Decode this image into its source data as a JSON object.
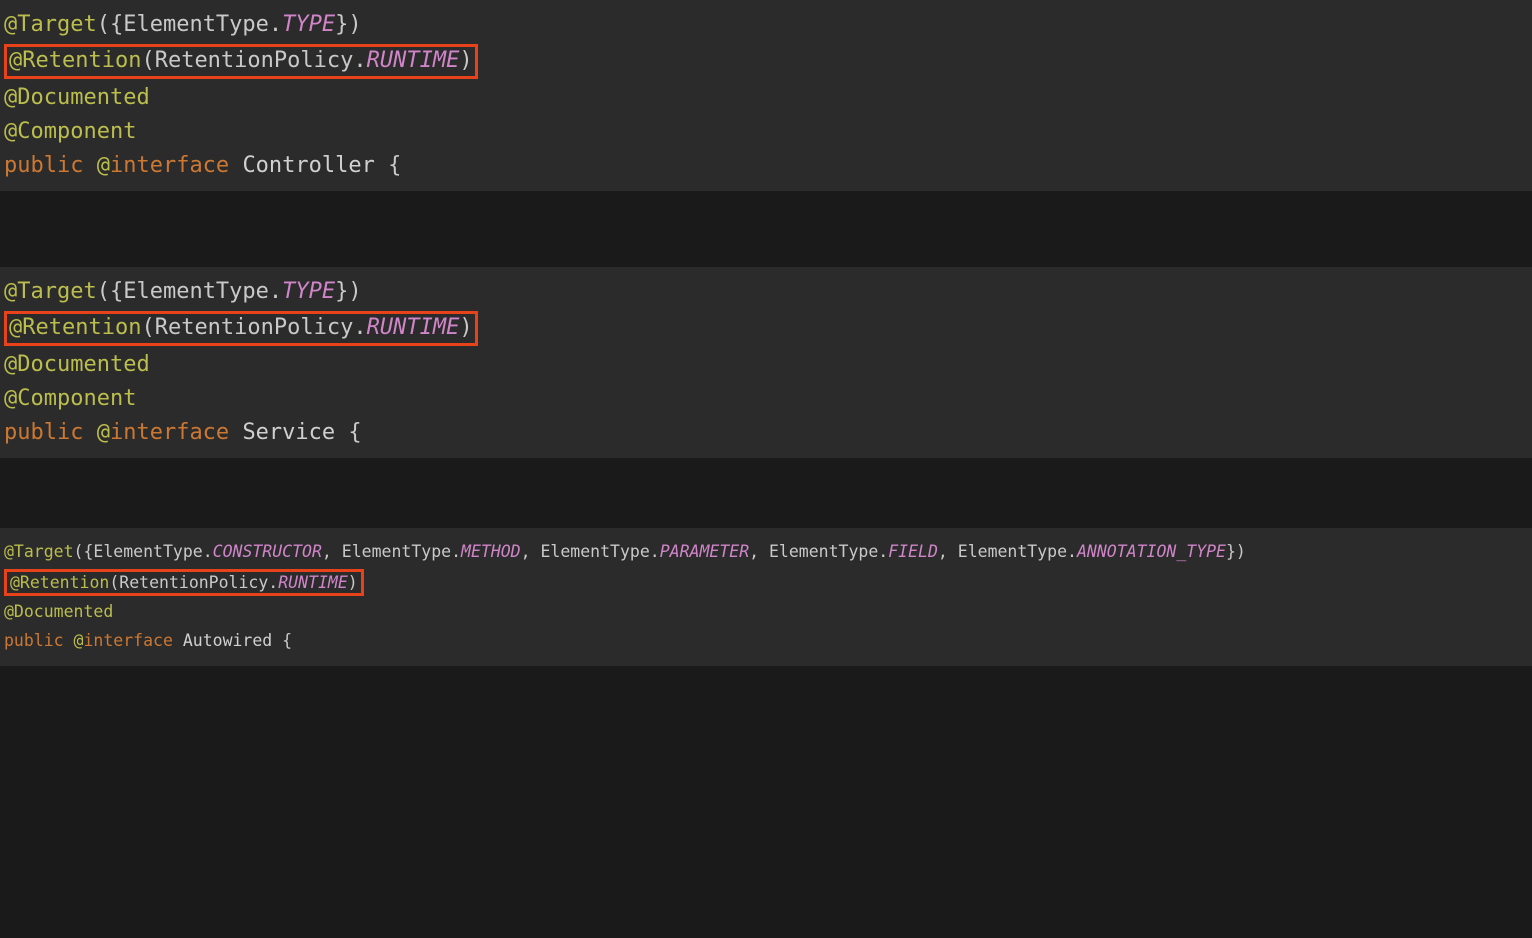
{
  "colors": {
    "annotation": "#BBBD4D",
    "constant": "#CF85C8",
    "keyword": "#CC7832",
    "text": "#d0d0d0",
    "highlight_border": "#E8421A",
    "editor_bg": "#2b2b2b",
    "page_bg": "#1a1a1a"
  },
  "blocks": [
    {
      "id": "controller-block",
      "font_scale": "large",
      "lines": {
        "target_at": "@Target",
        "target_open": "({",
        "target_type_class": "ElementType",
        "target_dot": ".",
        "target_const": "TYPE",
        "target_close": "})",
        "retention_at": "@Retention",
        "retention_open": "(",
        "retention_class": "RetentionPolicy",
        "retention_dot": ".",
        "retention_const": "RUNTIME",
        "retention_close": ")",
        "documented_at": "@Documented",
        "component_at": "@Component",
        "decl_public": "public ",
        "decl_at": "@",
        "decl_iface": "interface",
        "decl_space": " ",
        "decl_name": "Controller",
        "decl_brace": " {"
      }
    },
    {
      "id": "service-block",
      "font_scale": "large",
      "lines": {
        "target_at": "@Target",
        "target_open": "({",
        "target_type_class": "ElementType",
        "target_dot": ".",
        "target_const": "TYPE",
        "target_close": "})",
        "retention_at": "@Retention",
        "retention_open": "(",
        "retention_class": "RetentionPolicy",
        "retention_dot": ".",
        "retention_const": "RUNTIME",
        "retention_close": ")",
        "documented_at": "@Documented",
        "component_at": "@Component",
        "decl_public": "public ",
        "decl_at": "@",
        "decl_iface": "interface",
        "decl_space": " ",
        "decl_name": "Service",
        "decl_brace": " {"
      }
    },
    {
      "id": "autowired-block",
      "font_scale": "small",
      "lines": {
        "target_at": "@Target",
        "target_open": "({",
        "target_parts": [
          {
            "class": "ElementType",
            "dot": ".",
            "const": "CONSTRUCTOR",
            "suffix": ", "
          },
          {
            "class": "ElementType",
            "dot": ".",
            "const": "METHOD",
            "suffix": ", "
          },
          {
            "class": "ElementType",
            "dot": ".",
            "const": "PARAMETER",
            "suffix": ", "
          },
          {
            "class": "ElementType",
            "dot": ".",
            "const": "FIELD",
            "suffix": ", "
          },
          {
            "class": "ElementType",
            "dot": ".",
            "const": "ANNOTATION_TYPE",
            "suffix": ""
          }
        ],
        "target_close": "})",
        "retention_at": "@Retention",
        "retention_open": "(",
        "retention_class": "RetentionPolicy",
        "retention_dot": ".",
        "retention_const": "RUNTIME",
        "retention_close": ")",
        "documented_at": "@Documented",
        "decl_public": "public ",
        "decl_at": "@",
        "decl_iface": "interface",
        "decl_space": " ",
        "decl_name": "Autowired",
        "decl_brace": " {"
      }
    }
  ]
}
